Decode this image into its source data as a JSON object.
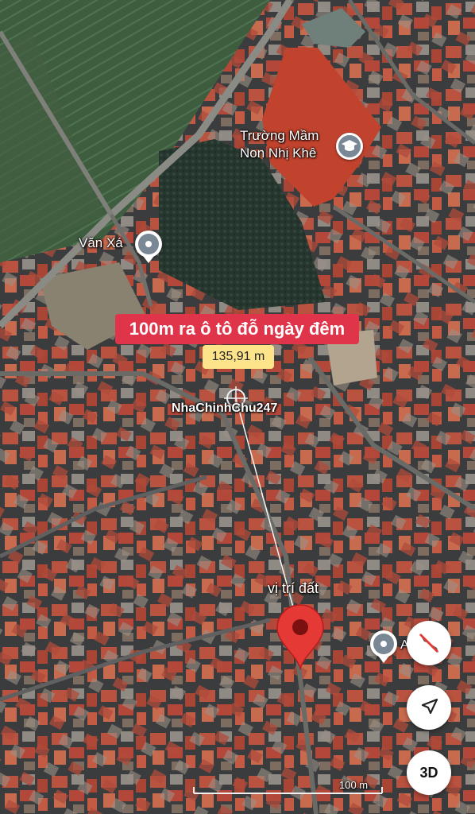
{
  "promo": {
    "banner": "100m ra ô tô đỗ ngày đêm",
    "distance": "135,91 m"
  },
  "places": {
    "school": {
      "line1": "Trường Mầm",
      "line2": "Non Nhị Khê",
      "icon": "school-icon"
    },
    "van_xa": {
      "label": "Văn Xá",
      "icon": "place-pin-icon"
    },
    "watermark": "NhaChinhChu247",
    "destination": {
      "label": "vị trí đất",
      "icon": "red-location-pin-icon",
      "color": "#e53935"
    },
    "right_partial": {
      "label": "A   s Đu",
      "icon": "place-pin-icon"
    }
  },
  "controls": {
    "compass": "compass-icon",
    "locate": "navigation-arrow-icon",
    "threeD": "3D"
  },
  "scale": {
    "label": "100 m"
  }
}
